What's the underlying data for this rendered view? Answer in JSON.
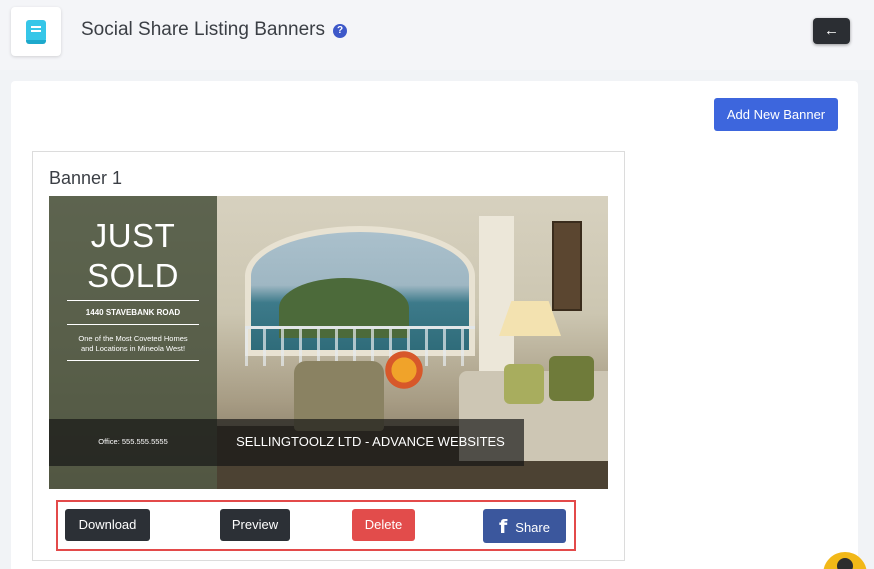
{
  "header": {
    "title": "Social Share Listing Banners",
    "help_icon": "?",
    "back_icon": "←",
    "logo_icon": "book-icon"
  },
  "toolbar": {
    "add_banner_label": "Add New Banner"
  },
  "banner": {
    "title": "Banner 1",
    "image": {
      "headline_line1": "JUST",
      "headline_line2": "SOLD",
      "address": "1440 STAVEBANK ROAD",
      "tagline_line1": "One of the Most Coveted Homes",
      "tagline_line2": "and Locations in Mineola West!",
      "office": "Office: 555.555.5555",
      "company": "SELLINGTOOLZ LTD - ADVANCE WEBSITES"
    },
    "actions": {
      "download_label": "Download",
      "preview_label": "Preview",
      "delete_label": "Delete",
      "share_icon": "f",
      "share_label": "Share"
    }
  },
  "colors": {
    "accent": "#3d66dd",
    "dark_button": "#2c3036",
    "delete": "#e24c4b",
    "facebook": "#3b579d",
    "highlight_border": "#e34a4a"
  }
}
